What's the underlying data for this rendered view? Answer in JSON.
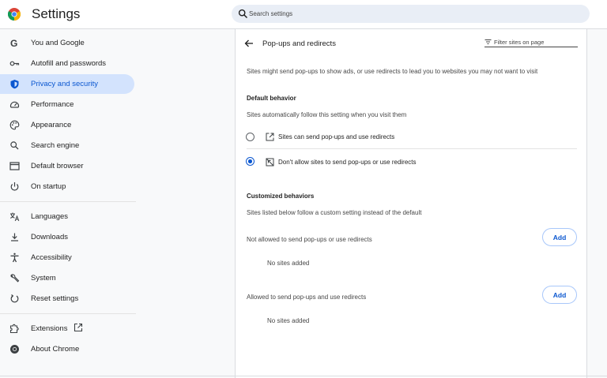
{
  "header": {
    "app_title": "Settings",
    "search": {
      "placeholder": "Search settings"
    }
  },
  "sidebar": {
    "items": [
      {
        "label": "You and Google",
        "icon": "google-g-icon"
      },
      {
        "label": "Autofill and passwords",
        "icon": "key-icon"
      },
      {
        "label": "Privacy and security",
        "icon": "shield-icon",
        "active": true
      },
      {
        "label": "Performance",
        "icon": "speedometer-icon"
      },
      {
        "label": "Appearance",
        "icon": "palette-icon"
      },
      {
        "label": "Search engine",
        "icon": "search-icon"
      },
      {
        "label": "Default browser",
        "icon": "browser-window-icon"
      },
      {
        "label": "On startup",
        "icon": "power-icon"
      },
      {
        "label": "Languages",
        "icon": "translate-icon"
      },
      {
        "label": "Downloads",
        "icon": "download-icon"
      },
      {
        "label": "Accessibility",
        "icon": "accessibility-icon"
      },
      {
        "label": "System",
        "icon": "wrench-icon"
      },
      {
        "label": "Reset settings",
        "icon": "reset-icon"
      },
      {
        "label": "Extensions",
        "icon": "puzzle-icon"
      },
      {
        "label": "About Chrome",
        "icon": "chrome-icon"
      }
    ]
  },
  "page": {
    "title": "Pop-ups and redirects",
    "filter": {
      "placeholder": "Filter sites on page"
    },
    "description": "Sites might send pop-ups to show ads, or use redirects to lead you to websites you may not want to visit",
    "default_behavior": {
      "heading": "Default behavior",
      "subtext": "Sites automatically follow this setting when you visit them",
      "options": [
        {
          "label": "Sites can send pop-ups and use redirects",
          "checked": false,
          "icon": "open-in-new-icon"
        },
        {
          "label": "Don't allow sites to send pop-ups or use redirects",
          "checked": true,
          "icon": "popup-blocked-icon"
        }
      ]
    },
    "customized": {
      "heading": "Customized behaviors",
      "subtext": "Sites listed below follow a custom setting instead of the default",
      "not_allowed": {
        "label": "Not allowed to send pop-ups or use redirects",
        "add_label": "Add",
        "empty": "No sites added"
      },
      "allowed": {
        "label": "Allowed to send pop-ups and use redirects",
        "add_label": "Add",
        "empty": "No sites added"
      }
    }
  },
  "colors": {
    "accent": "#0b57d0",
    "active_bg": "#d3e3fd",
    "page_bg": "#f8f9fa"
  }
}
